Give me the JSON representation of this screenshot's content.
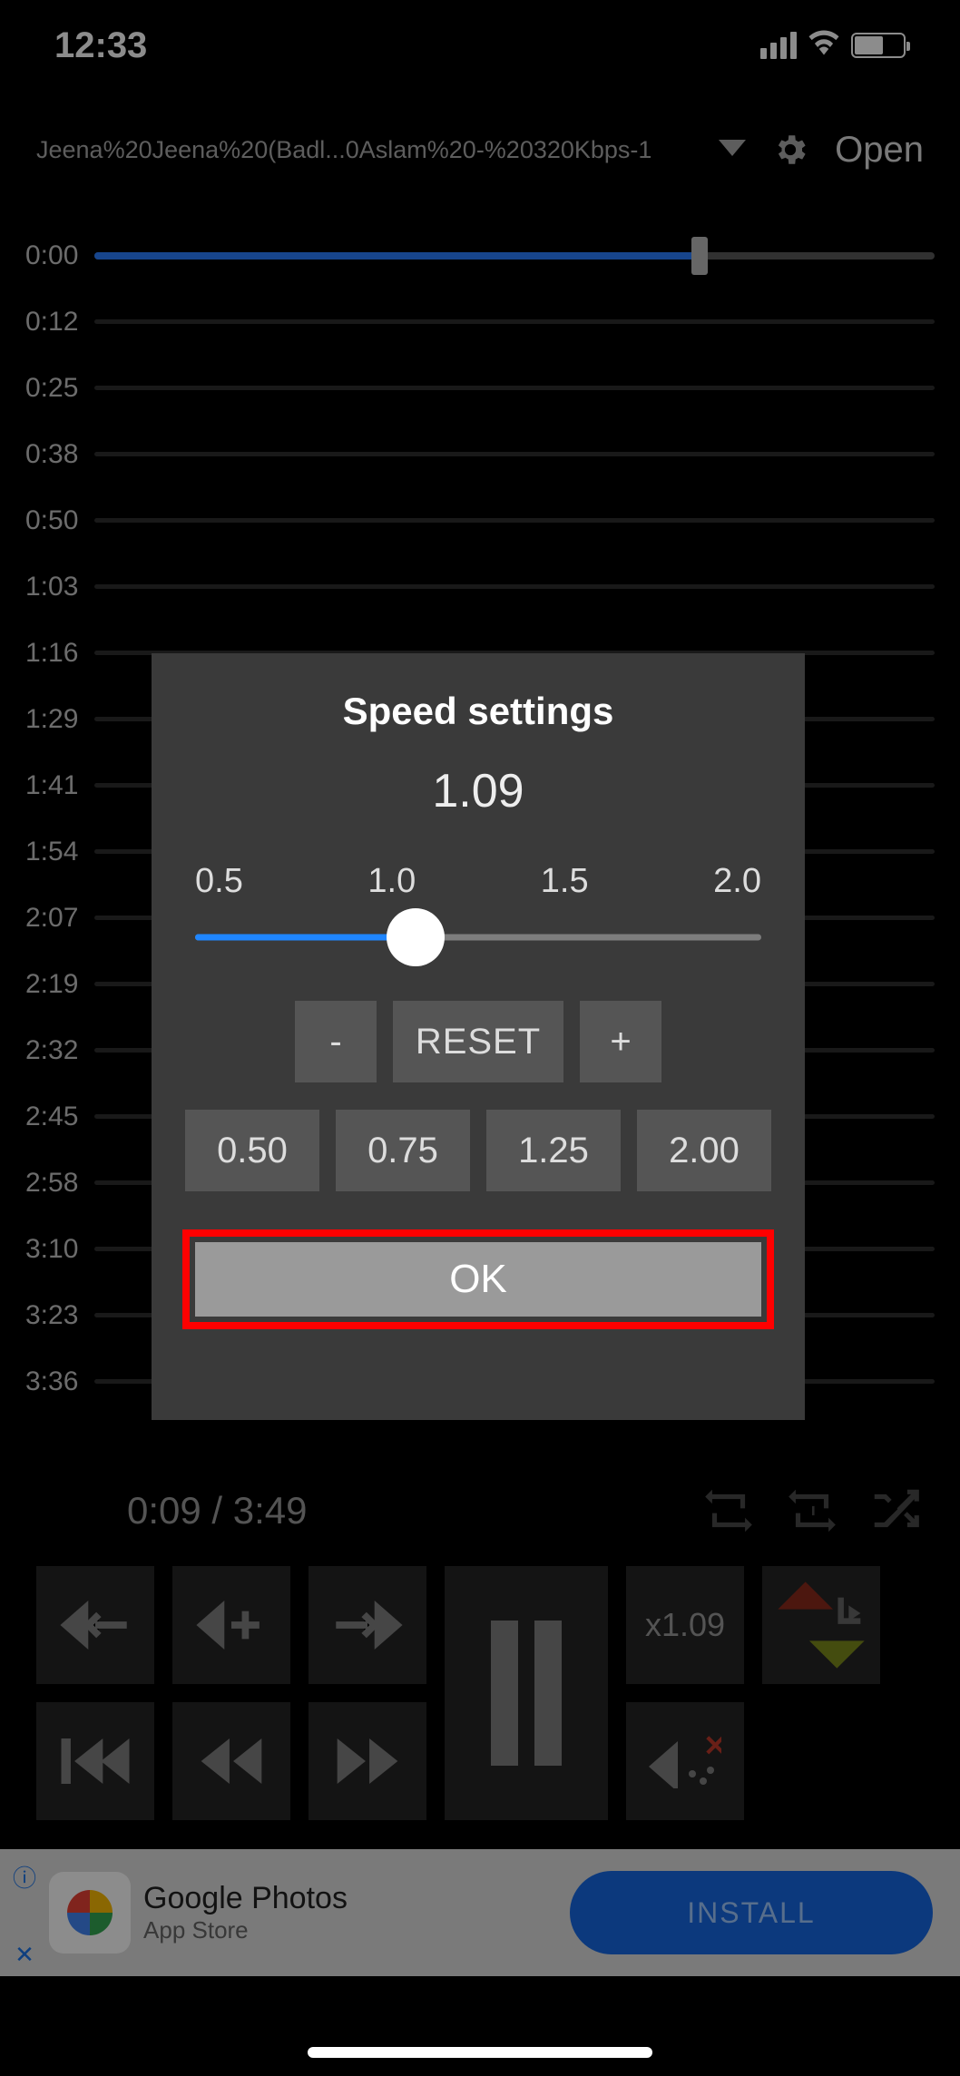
{
  "status": {
    "time": "12:33"
  },
  "nav": {
    "title": "Jeena%20Jeena%20(Badl...0Aslam%20-%20320Kbps-1",
    "open": "Open"
  },
  "timeline": {
    "main_progress_pct": 72,
    "labels": [
      "0:00",
      "0:12",
      "0:25",
      "0:38",
      "0:50",
      "1:03",
      "1:16",
      "1:29",
      "1:41",
      "1:54",
      "2:07",
      "2:19",
      "2:32",
      "2:45",
      "2:58",
      "3:10",
      "3:23",
      "3:36"
    ]
  },
  "footer": {
    "elapsed": "0:09",
    "total": "3:49",
    "speed": "x1.09"
  },
  "dialog": {
    "title": "Speed settings",
    "value": "1.09",
    "scale": [
      "0.5",
      "1.0",
      "1.5",
      "2.0"
    ],
    "slider_pct": 39,
    "minus": "-",
    "reset": "RESET",
    "plus": "+",
    "presets": [
      "0.50",
      "0.75",
      "1.25",
      "2.00"
    ],
    "ok": "OK"
  },
  "ad": {
    "title": "Google Photos",
    "subtitle": "App Store",
    "cta": "INSTALL"
  }
}
